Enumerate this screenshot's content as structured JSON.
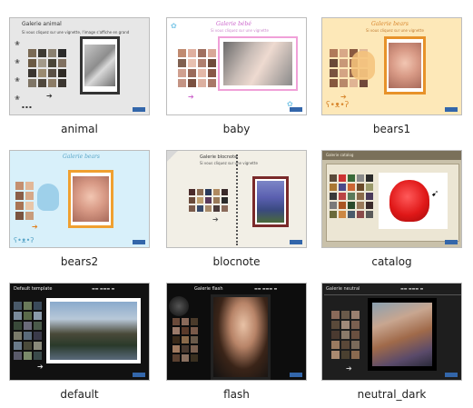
{
  "themes": [
    {
      "label": "animal",
      "title": "Galerie animal",
      "subtitle": "Si vous cliquez sur une vignette, l'image s'affiche en grand",
      "colors": {
        "bg": "#e7e7e7",
        "accent": "#444444",
        "photo_border": "#333333"
      }
    },
    {
      "label": "baby",
      "title": "Galerie bébé",
      "subtitle": "Si vous cliquez sur une vignette",
      "colors": {
        "bg": "#ffffff",
        "accent": "#cc66cc",
        "photo_border": "#f0a0d8"
      }
    },
    {
      "label": "bears1",
      "title": "Galerie bears",
      "subtitle": "Si vous cliquez sur une vignette",
      "colors": {
        "bg": "#fde8b8",
        "accent": "#d98830",
        "photo_border": "#e7922a"
      }
    },
    {
      "label": "bears2",
      "title": "Galerie bears",
      "subtitle": "",
      "colors": {
        "bg": "#d8f0fa",
        "accent": "#5aa6c8",
        "photo_border": "#f0a030"
      }
    },
    {
      "label": "blocnote",
      "title": "Galerie blocnote",
      "subtitle": "Si vous cliquez sur une vignette",
      "colors": {
        "bg": "#f2efe6",
        "accent": "#555555",
        "photo_border": "#7a2a2a"
      }
    },
    {
      "label": "catalog",
      "title": "Galerie catalog",
      "subtitle": "",
      "colors": {
        "bg": "#c9c1aa",
        "accent": "#7a705a",
        "photo_border": "#ffffff"
      }
    },
    {
      "label": "default",
      "title": "Default template",
      "subtitle": "",
      "colors": {
        "bg": "#111111",
        "accent": "#dddddd",
        "photo_border": "#ffffff"
      }
    },
    {
      "label": "flash",
      "title": "Galerie flash",
      "subtitle": "",
      "colors": {
        "bg": "#0d0d0d",
        "accent": "#dddddd",
        "photo_border": "#222222"
      }
    },
    {
      "label": "neutral_dark",
      "title": "Galerie neutral",
      "subtitle": "",
      "colors": {
        "bg": "#1e1e1e",
        "accent": "#cccccc",
        "photo_border": "#000000"
      }
    }
  ]
}
